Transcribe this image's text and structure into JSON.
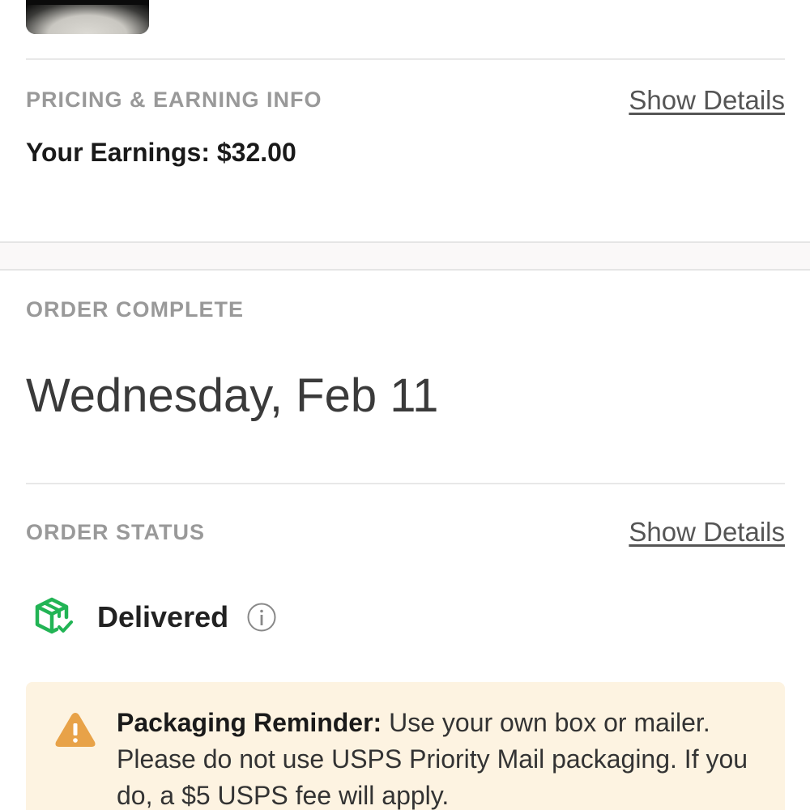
{
  "pricing": {
    "label": "PRICING & EARNING INFO",
    "show_details": "Show Details",
    "earnings_text": "Your Earnings: $32.00"
  },
  "order_complete": {
    "label": "ORDER COMPLETE",
    "date": "Wednesday, Feb 11"
  },
  "order_status": {
    "label": "ORDER STATUS",
    "show_details": "Show Details",
    "status": "Delivered",
    "status_icon": "package-delivered-icon",
    "info_icon": "info-icon"
  },
  "notice": {
    "icon": "warning-icon",
    "title": "Packaging Reminder:",
    "body": " Use your own box or mailer. Please do not use USPS Priority Mail packaging. If you do, a $5 USPS fee will apply."
  },
  "colors": {
    "status_green": "#22b455",
    "warning_orange": "#e8a248",
    "notice_bg": "#fdf3e1"
  }
}
